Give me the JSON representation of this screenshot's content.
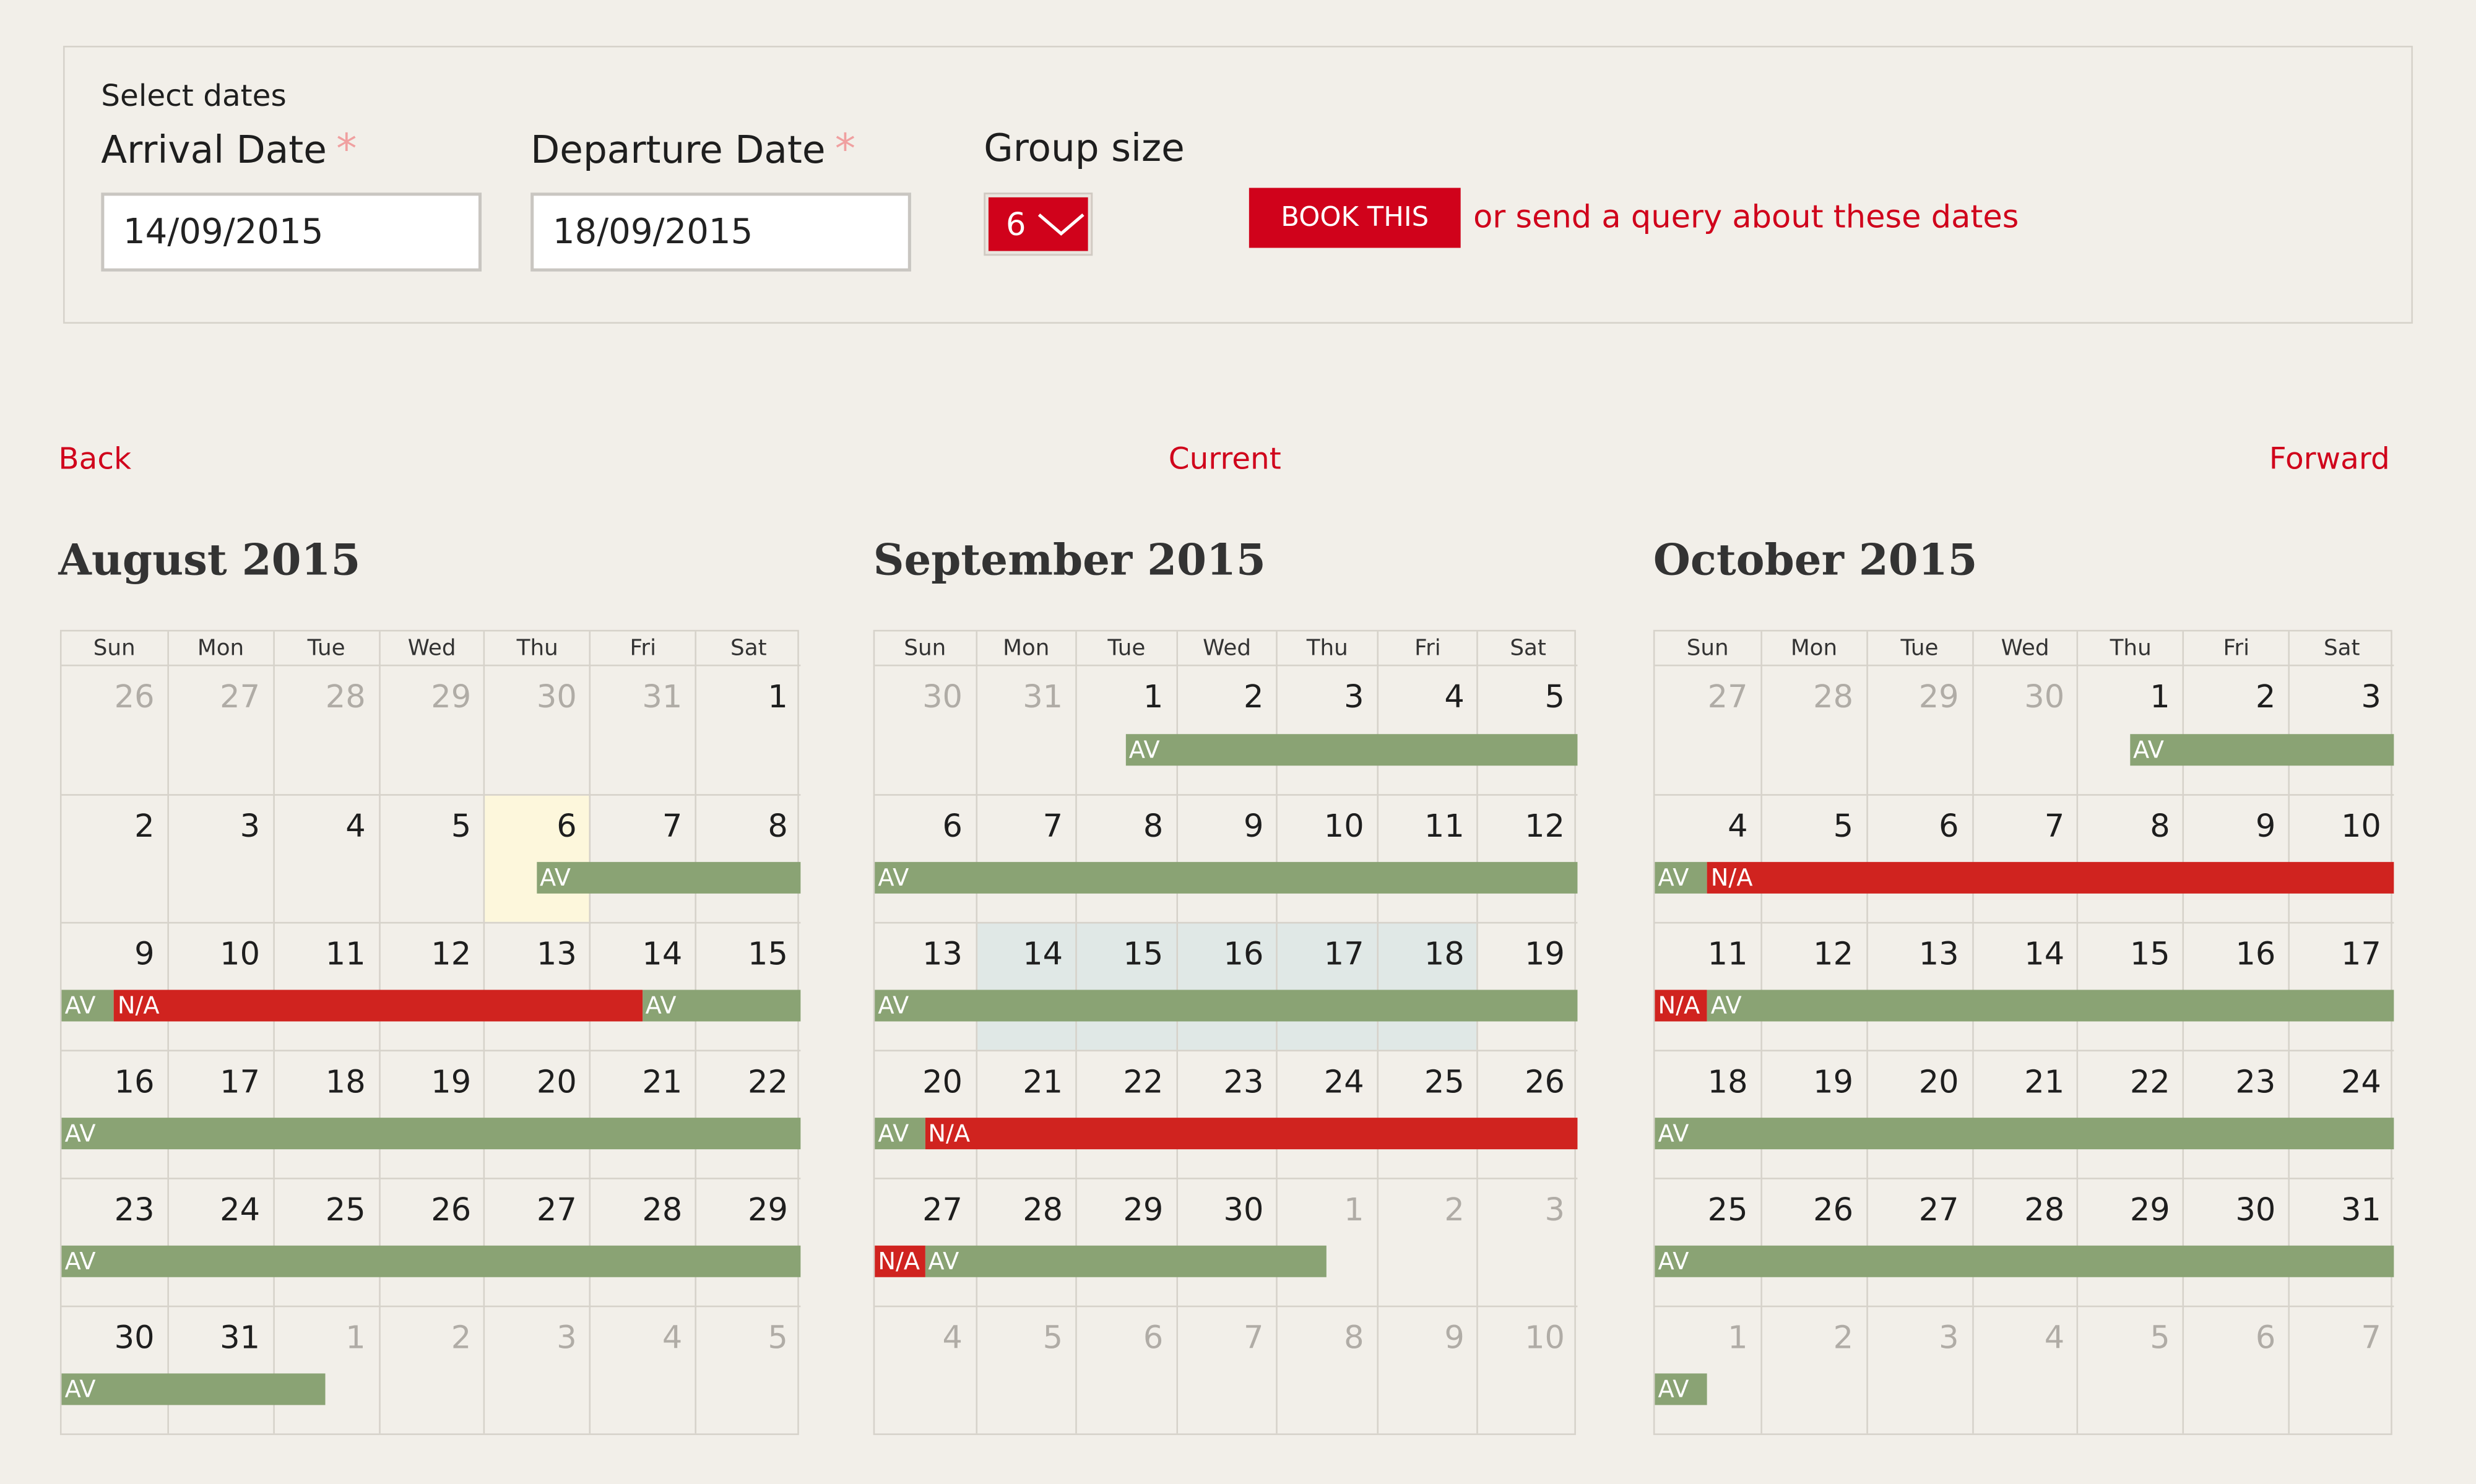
{
  "form": {
    "heading": "Select dates",
    "arrival_label": "Arrival Date",
    "departure_label": "Departure Date",
    "required_mark": "*",
    "group_label": "Group size",
    "arrival_value": "14/09/2015",
    "departure_value": "18/09/2015",
    "group_value": "6",
    "book_label": "BOOK THIS",
    "query_link": "or send a query about these dates"
  },
  "nav": {
    "back": "Back",
    "current": "Current",
    "forward": "Forward"
  },
  "weekdays": [
    "Sun",
    "Mon",
    "Tue",
    "Wed",
    "Thu",
    "Fri",
    "Sat"
  ],
  "status_labels": {
    "av": "AV",
    "na": "N/A"
  },
  "colors": {
    "accent": "#d0021b",
    "available": "#8aa374",
    "not_available": "#d0231f",
    "background": "#f2efe9",
    "today_highlight": "#fdf7dc",
    "selected_range": "#e0e8e6"
  },
  "months": [
    {
      "title": "August 2015",
      "weeks": [
        {
          "days": [
            26,
            27,
            28,
            29,
            30,
            31,
            1
          ],
          "other": [
            0,
            1,
            2,
            3,
            4,
            5
          ],
          "bars": []
        },
        {
          "days": [
            2,
            3,
            4,
            5,
            6,
            7,
            8
          ],
          "other": [],
          "today": [
            4
          ],
          "bars": [
            {
              "s": "av",
              "from": 4.5,
              "to": 7
            }
          ]
        },
        {
          "days": [
            9,
            10,
            11,
            12,
            13,
            14,
            15
          ],
          "other": [],
          "bars": [
            {
              "s": "av",
              "from": 0,
              "to": 0.5
            },
            {
              "s": "na",
              "from": 0.5,
              "to": 5.5
            },
            {
              "s": "av",
              "from": 5.5,
              "to": 7
            }
          ]
        },
        {
          "days": [
            16,
            17,
            18,
            19,
            20,
            21,
            22
          ],
          "other": [],
          "bars": [
            {
              "s": "av",
              "from": 0,
              "to": 7
            }
          ]
        },
        {
          "days": [
            23,
            24,
            25,
            26,
            27,
            28,
            29
          ],
          "other": [],
          "bars": [
            {
              "s": "av",
              "from": 0,
              "to": 7
            }
          ]
        },
        {
          "days": [
            30,
            31,
            1,
            2,
            3,
            4,
            5
          ],
          "other": [
            2,
            3,
            4,
            5,
            6
          ],
          "bars": [
            {
              "s": "av",
              "from": 0,
              "to": 2.5
            }
          ]
        }
      ]
    },
    {
      "title": "September 2015",
      "weeks": [
        {
          "days": [
            30,
            31,
            1,
            2,
            3,
            4,
            5
          ],
          "other": [
            0,
            1
          ],
          "bars": [
            {
              "s": "av",
              "from": 2.5,
              "to": 7
            }
          ]
        },
        {
          "days": [
            6,
            7,
            8,
            9,
            10,
            11,
            12
          ],
          "other": [],
          "bars": [
            {
              "s": "av",
              "from": 0,
              "to": 7
            }
          ]
        },
        {
          "days": [
            13,
            14,
            15,
            16,
            17,
            18,
            19
          ],
          "other": [],
          "selected": [
            1,
            2,
            3,
            4,
            5
          ],
          "bars": [
            {
              "s": "av",
              "from": 0,
              "to": 7
            }
          ]
        },
        {
          "days": [
            20,
            21,
            22,
            23,
            24,
            25,
            26
          ],
          "other": [],
          "bars": [
            {
              "s": "av",
              "from": 0,
              "to": 0.5
            },
            {
              "s": "na",
              "from": 0.5,
              "to": 7
            }
          ]
        },
        {
          "days": [
            27,
            28,
            29,
            30,
            1,
            2,
            3
          ],
          "other": [
            4,
            5,
            6
          ],
          "bars": [
            {
              "s": "na",
              "from": 0,
              "to": 0.5
            },
            {
              "s": "av",
              "from": 0.5,
              "to": 4.5
            }
          ]
        },
        {
          "days": [
            4,
            5,
            6,
            7,
            8,
            9,
            10
          ],
          "other": [
            0,
            1,
            2,
            3,
            4,
            5,
            6
          ],
          "bars": []
        }
      ]
    },
    {
      "title": "October 2015",
      "weeks": [
        {
          "days": [
            27,
            28,
            29,
            30,
            1,
            2,
            3
          ],
          "other": [
            0,
            1,
            2,
            3
          ],
          "bars": [
            {
              "s": "av",
              "from": 4.5,
              "to": 7
            }
          ]
        },
        {
          "days": [
            4,
            5,
            6,
            7,
            8,
            9,
            10
          ],
          "other": [],
          "bars": [
            {
              "s": "av",
              "from": 0,
              "to": 0.5
            },
            {
              "s": "na",
              "from": 0.5,
              "to": 7
            }
          ]
        },
        {
          "days": [
            11,
            12,
            13,
            14,
            15,
            16,
            17
          ],
          "other": [],
          "bars": [
            {
              "s": "na",
              "from": 0,
              "to": 0.5
            },
            {
              "s": "av",
              "from": 0.5,
              "to": 7
            }
          ]
        },
        {
          "days": [
            18,
            19,
            20,
            21,
            22,
            23,
            24
          ],
          "other": [],
          "bars": [
            {
              "s": "av",
              "from": 0,
              "to": 7
            }
          ]
        },
        {
          "days": [
            25,
            26,
            27,
            28,
            29,
            30,
            31
          ],
          "other": [],
          "bars": [
            {
              "s": "av",
              "from": 0,
              "to": 7
            }
          ]
        },
        {
          "days": [
            1,
            2,
            3,
            4,
            5,
            6,
            7
          ],
          "other": [
            0,
            1,
            2,
            3,
            4,
            5,
            6
          ],
          "bars": [
            {
              "s": "av",
              "from": 0,
              "to": 0.5
            }
          ]
        }
      ]
    }
  ]
}
